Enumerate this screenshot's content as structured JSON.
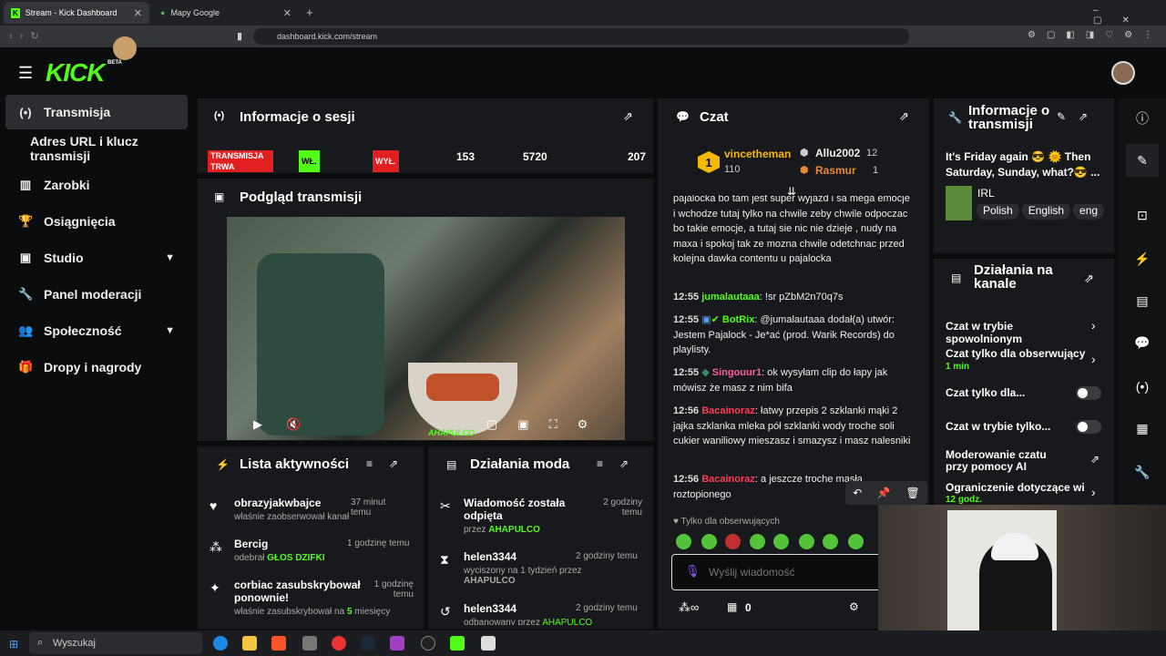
{
  "browser": {
    "tab1": "Stream - Kick Dashboard",
    "tab2": "Mapy Google",
    "url": "dashboard.kick.com/stream",
    "new_tab": "+"
  },
  "logo": {
    "text": "KICK",
    "beta": "BETA"
  },
  "sidebar": {
    "items": [
      {
        "label": "Transmisja"
      },
      {
        "label": "Adres URL i klucz transmisji"
      },
      {
        "label": "Zarobki"
      },
      {
        "label": "Osiągnięcia"
      },
      {
        "label": "Studio"
      },
      {
        "label": "Panel moderacji"
      },
      {
        "label": "Społeczność"
      },
      {
        "label": "Dropy i nagrody"
      }
    ]
  },
  "session": {
    "title": "Informacje o sesji",
    "status_live": "TRANSMISJA TRWA",
    "on": "WŁ.",
    "off": "WYŁ.",
    "stat1": "153",
    "stat2": "5720",
    "stat3": "207"
  },
  "preview": {
    "title": "Podgląd transmisji",
    "overlay_tag": "AHAPULCO"
  },
  "activity": {
    "title": "Lista aktywności",
    "items": [
      {
        "name": "obrazyjakwbajce",
        "time": "37 minut temu",
        "desc": "właśnie zaobserwował kanał",
        "sub": ""
      },
      {
        "name": "Bercig",
        "time": "1 godzinę temu",
        "desc": "odebrał",
        "sub": "GŁOS DZIFKI"
      },
      {
        "name": "corbiac zasubskrybował ponownie!",
        "time": "1 godzinę temu",
        "desc": "właśnie zasubskrybował na",
        "sub": "5",
        "sub2": "miesięcy"
      }
    ]
  },
  "modactions": {
    "title": "Działania moda",
    "items": [
      {
        "name": "Wiadomość została odpięta",
        "time": "2 godziny temu",
        "desc": "przez",
        "by": "AHAPULCO"
      },
      {
        "name": "helen3344",
        "time": "2 godziny temu",
        "desc": "wyciszony na 1 tydzień przez",
        "by": "AHAPULCO"
      },
      {
        "name": "helen3344",
        "time": "2 godziny temu",
        "desc": "odbanowany przez",
        "by": "AHAPULCO"
      }
    ]
  },
  "chat": {
    "title": "Czat",
    "lb": {
      "rank": "1",
      "user1": "vincetheman",
      "count1": "110",
      "user2": "Allu2002",
      "count2": "12",
      "user3": "Rasmur",
      "count3": "1"
    },
    "messages": [
      {
        "time": "",
        "user": "",
        "text": "pajalocka bo tam jest super wyjazd i sa mega emocje i wchodze tutaj tylko na chwile zeby chwile odpoczac bo takie emocje, a tutaj sie nic nie dzieje , nudy na maxa i spokoj tak ze mozna chwile odetchnac przed kolejna dawka contentu u pajalocka"
      },
      {
        "time": "12:55",
        "user": "jumalautaaa",
        "text": ": !sr pZbM2n70q7s"
      },
      {
        "time": "12:55",
        "user": "BotRix",
        "text": ": @jumalautaaa dodał(a) utwór: Jestem Pajalock - Je*ać (prod. Warik Records) do playlisty."
      },
      {
        "time": "12:55",
        "user": "Singouur1",
        "text": ": ok wysyłam clip do łapy jak mówisz że masz z nim bifa"
      },
      {
        "time": "12:56",
        "user": "Bacainoraz",
        "text": ": łatwy przepis 2 szklanki mąki 2 jajka szklanka mleka pół szklanki wody troche soli cukier waniliowy mieszasz i smazysz i masz nalesniki"
      },
      {
        "time": "12:56",
        "user": "Bacainoraz",
        "text": ": a jeszcze troche masła roztopionego"
      }
    ],
    "followers_only": "Tylko dla obserwujących",
    "placeholder": "Wyślij wiadomość",
    "count": "0"
  },
  "streaminfo": {
    "title": "Informacje o transmisji",
    "desc": "It's Friday again 😎 🌞 Then Saturday, Sunday, what?😎 ...",
    "category": "IRL",
    "tags": [
      "Polish",
      "English",
      "eng"
    ]
  },
  "channel": {
    "title": "Działania na kanale",
    "items": [
      {
        "label": "Czat w trybie spowolnionym",
        "sub": ""
      },
      {
        "label": "Czat tylko dla obserwujący",
        "sub": "1 min"
      },
      {
        "label": "Czat tylko dla...",
        "sub": ""
      },
      {
        "label": "Czat w trybie tylko...",
        "sub": ""
      },
      {
        "label": "Moderowanie czatu przy pomocy AI",
        "sub": ""
      },
      {
        "label": "Ograniczenie dotyczące wi",
        "sub": "12 godz."
      }
    ]
  },
  "taskbar": {
    "search": "Wyszukaj"
  },
  "colors": {
    "accent": "#53fc18",
    "live": "#e02020",
    "bg": "#0b0c0e",
    "panel": "#18191c"
  }
}
